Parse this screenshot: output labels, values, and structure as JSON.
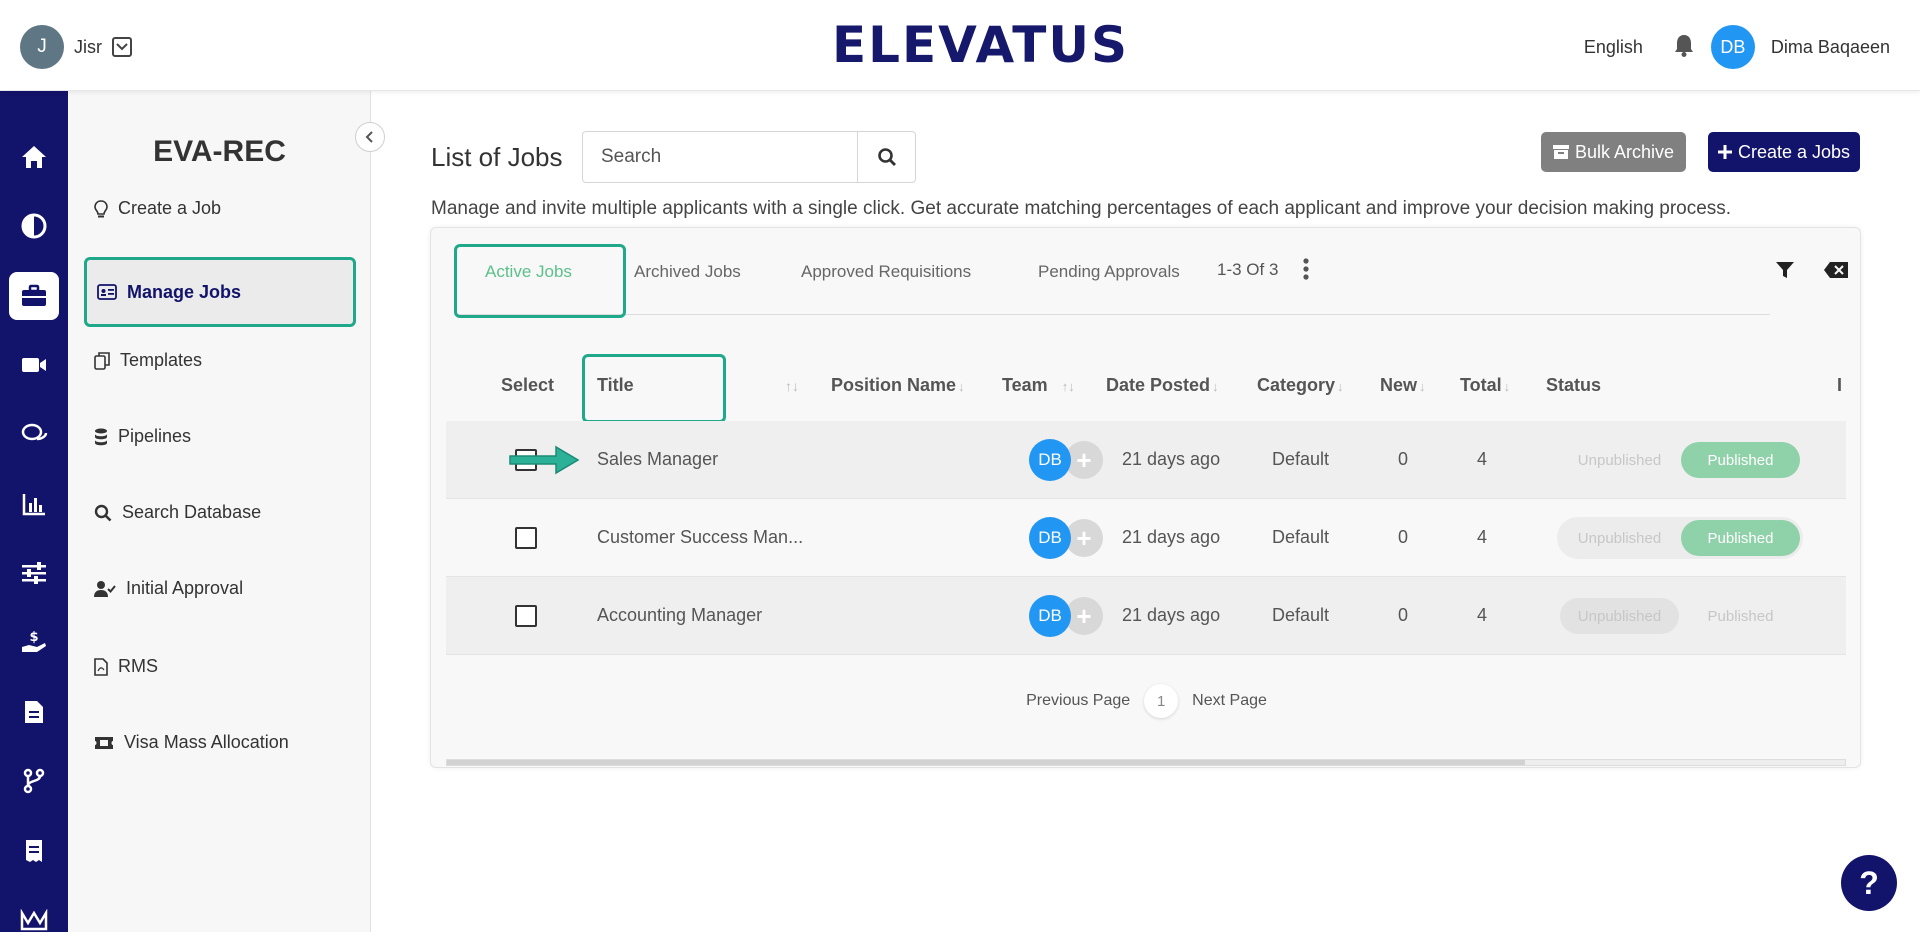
{
  "header": {
    "account_initial": "J",
    "account_name": "Jisr",
    "logo_text": "ELEVATUS",
    "language": "English",
    "user_initials": "DB",
    "user_name": "Dima Baqaeen"
  },
  "rail": {
    "items": [
      "home-icon",
      "half-circle-icon",
      "briefcase-icon",
      "video-icon",
      "chat-icon",
      "bar-chart-icon",
      "sliders-icon",
      "hand-dollar-icon",
      "document-icon",
      "branch-icon",
      "receipt-icon",
      "crown-icon"
    ],
    "active_index": 2
  },
  "sidebar": {
    "title": "EVA-REC",
    "items": [
      {
        "label": "Create a Job",
        "icon": "lightbulb-icon"
      },
      {
        "label": "Manage Jobs",
        "icon": "id-card-icon"
      },
      {
        "label": "Templates",
        "icon": "copy-icon"
      },
      {
        "label": "Pipelines",
        "icon": "database-icon"
      },
      {
        "label": "Search Database",
        "icon": "search-icon"
      },
      {
        "label": "Initial Approval",
        "icon": "user-check-icon"
      },
      {
        "label": "RMS",
        "icon": "pdf-file-icon"
      },
      {
        "label": "Visa Mass Allocation",
        "icon": "ticket-icon"
      }
    ]
  },
  "main": {
    "title": "List of Jobs",
    "search_placeholder": "Search",
    "bulk_archive_label": "Bulk Archive",
    "create_label": "Create a Jobs",
    "description": "Manage and invite multiple applicants with a single click. Get accurate matching percentages of each applicant and improve your decision making process.",
    "tabs": [
      "Active Jobs",
      "Archived Jobs",
      "Approved Requisitions",
      "Pending Approvals"
    ],
    "count_label": "1-3 Of 3",
    "columns": [
      "Select",
      "Title",
      "Position Name",
      "Team",
      "Date Posted",
      "Category",
      "New",
      "Total",
      "Status",
      "I"
    ],
    "rows": [
      {
        "title": "Sales Manager",
        "team": "DB",
        "date": "21 days ago",
        "category": "Default",
        "new": "0",
        "total": "4",
        "published": true
      },
      {
        "title": "Customer Success Man...",
        "team": "DB",
        "date": "21 days ago",
        "category": "Default",
        "new": "0",
        "total": "4",
        "published": true
      },
      {
        "title": "Accounting Manager",
        "team": "DB",
        "date": "21 days ago",
        "category": "Default",
        "new": "0",
        "total": "4",
        "published": false
      }
    ],
    "status_unpublished": "Unpublished",
    "status_published": "Published",
    "prev_label": "Previous Page",
    "page": "1",
    "next_label": "Next Page"
  },
  "help_label": "?",
  "colors": {
    "brand": "#12136a",
    "accent": "#1fa88a",
    "published": "#8fd1a9",
    "avatar": "#2196f3"
  }
}
